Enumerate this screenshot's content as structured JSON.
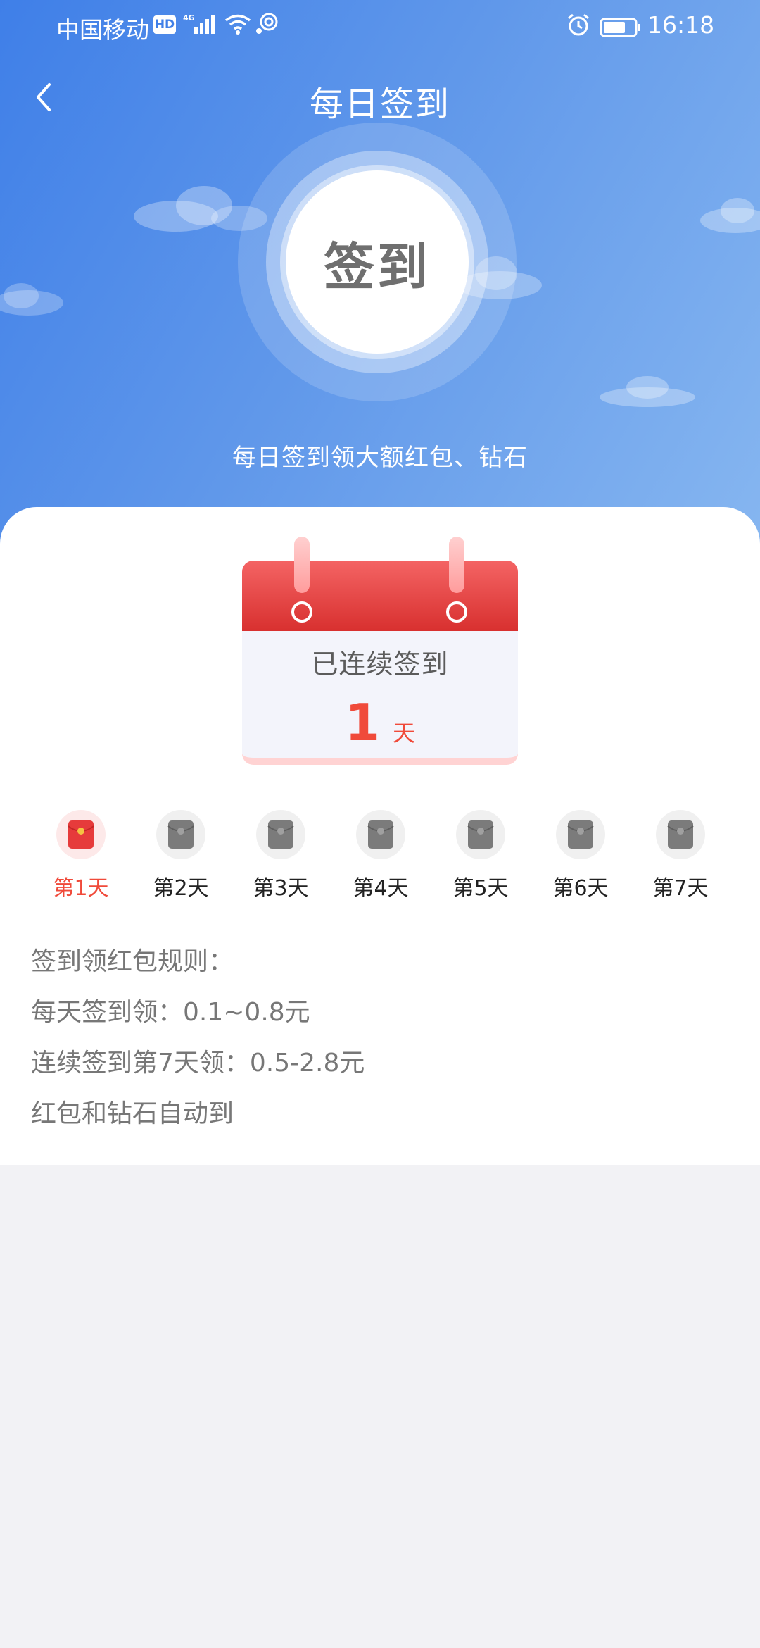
{
  "status_bar": {
    "carrier": "中国移动",
    "hd_badge": "HD",
    "network": "4G",
    "time": "16:18",
    "icons": [
      "hd-icon",
      "signal-icon",
      "wifi-icon",
      "hotspot-icon",
      "alarm-icon",
      "battery-icon"
    ]
  },
  "header": {
    "title": "每日签到",
    "back_icon": "chevron-left-icon",
    "signin_button_label": "签到",
    "subtitle": "每日签到领大额红包、钻石",
    "colors": {
      "gradient_start": "#3f7fe8",
      "gradient_end": "#86b6f0"
    }
  },
  "calendar": {
    "label": "已连续签到",
    "days": "1",
    "unit": "天",
    "colors": {
      "top": "#e0393a",
      "accent_text": "#f04a3a"
    }
  },
  "days": [
    {
      "label": "第1天",
      "status": "active",
      "icon": "red-envelope-icon"
    },
    {
      "label": "第2天",
      "status": "inactive",
      "icon": "grey-envelope-icon"
    },
    {
      "label": "第3天",
      "status": "inactive",
      "icon": "grey-envelope-icon"
    },
    {
      "label": "第4天",
      "status": "inactive",
      "icon": "grey-envelope-icon"
    },
    {
      "label": "第5天",
      "status": "inactive",
      "icon": "grey-envelope-icon"
    },
    {
      "label": "第6天",
      "status": "inactive",
      "icon": "grey-envelope-icon"
    },
    {
      "label": "第7天",
      "status": "inactive",
      "icon": "grey-envelope-icon"
    }
  ],
  "rules": {
    "title": "签到领红包规则：",
    "lines": [
      "每天签到领：0.1~0.8元",
      "连续签到第7天领：0.5-2.8元",
      "红包和钻石自动到"
    ]
  }
}
